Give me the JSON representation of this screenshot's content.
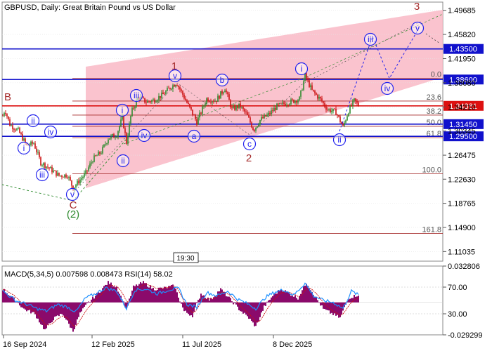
{
  "header": {
    "title": "GBPUSD, Daily:  Great Britain Pound vs US Dollar",
    "indicator_label": "MACD(5,34,5) 0.007598 0.008473 RSI(14) 58.02",
    "time_label": "19:30"
  },
  "colors": {
    "channel_fill": "#f9b9c6",
    "level_blue": "#1111cc",
    "level_red": "#dd1111",
    "fib_line": "#a52a2a",
    "wave_circle": "#2222ee",
    "wave_label_red": "#a52a2a",
    "wave_label_green": "#2e8b2e",
    "candle_up": "#2e8b2e",
    "candle_down": "#cc1111",
    "macd_hist": "#8b0a6b",
    "rsi_line": "#1e90ff",
    "signal_line": "#cc1111",
    "dashed_green": "#2e8b2e"
  },
  "chart_data": [
    {
      "type": "candlestick",
      "title": "GBPUSD, Daily:  Great Britain Pound vs US Dollar",
      "x_tick_labels": [
        "16 Sep 2024",
        "12 Feb 2025",
        "11 Jul 2025",
        "8 Dec 2025"
      ],
      "y_tick_labels": [
        "1.49685",
        "1.45820",
        "1.41950",
        "1.38080",
        "1.34210",
        "1.30345",
        "1.26475",
        "1.22630",
        "1.18765",
        "1.14900",
        "1.11035"
      ],
      "ylim": [
        1.095,
        1.51
      ],
      "grid": true,
      "price_path": [
        [
          0,
          1.328
        ],
        [
          3,
          1.338
        ],
        [
          10,
          1.314
        ],
        [
          22,
          1.304
        ],
        [
          34,
          1.28
        ],
        [
          44,
          1.284
        ],
        [
          54,
          1.253
        ],
        [
          66,
          1.244
        ],
        [
          80,
          1.232
        ],
        [
          92,
          1.233
        ],
        [
          100,
          1.212
        ],
        [
          108,
          1.223
        ],
        [
          118,
          1.236
        ],
        [
          128,
          1.258
        ],
        [
          140,
          1.27
        ],
        [
          150,
          1.292
        ],
        [
          162,
          1.298
        ],
        [
          170,
          1.325
        ],
        [
          176,
          1.285
        ],
        [
          183,
          1.334
        ],
        [
          193,
          1.358
        ],
        [
          204,
          1.35
        ],
        [
          215,
          1.353
        ],
        [
          228,
          1.362
        ],
        [
          238,
          1.373
        ],
        [
          247,
          1.381
        ],
        [
          256,
          1.362
        ],
        [
          266,
          1.34
        ],
        [
          276,
          1.318
        ],
        [
          290,
          1.355
        ],
        [
          303,
          1.352
        ],
        [
          316,
          1.372
        ],
        [
          326,
          1.338
        ],
        [
          337,
          1.344
        ],
        [
          347,
          1.33
        ],
        [
          357,
          1.305
        ],
        [
          366,
          1.321
        ],
        [
          378,
          1.33
        ],
        [
          390,
          1.343
        ],
        [
          402,
          1.348
        ],
        [
          414,
          1.352
        ],
        [
          422,
          1.355
        ],
        [
          430,
          1.392
        ],
        [
          440,
          1.368
        ],
        [
          452,
          1.354
        ],
        [
          462,
          1.338
        ],
        [
          474,
          1.334
        ],
        [
          484,
          1.31
        ],
        [
          492,
          1.336
        ],
        [
          500,
          1.352
        ],
        [
          506,
          1.345
        ]
      ],
      "levels": [
        {
          "label": "1.43500",
          "value": 1.435,
          "style": "blue"
        },
        {
          "label": "1.38600",
          "value": 1.386,
          "style": "blue"
        },
        {
          "label": "1.34381",
          "value": 1.34381,
          "style": "red"
        },
        {
          "label": "1.31450",
          "value": 1.3145,
          "style": "blue"
        },
        {
          "label": "1.29500",
          "value": 1.295,
          "style": "blue"
        }
      ],
      "fibonacci": [
        {
          "label": "0.0",
          "value": 1.388
        },
        {
          "label": "23.6",
          "value": 1.3515
        },
        {
          "label": "38.2",
          "value": 1.329
        },
        {
          "label": "50.0",
          "value": 1.311
        },
        {
          "label": "61.8",
          "value": 1.2928
        },
        {
          "label": "100.0",
          "value": 1.235
        },
        {
          "label": "161.8",
          "value": 1.1395
        }
      ],
      "waves": {
        "labels_red": [
          "B",
          "C",
          "1",
          "2",
          "3"
        ],
        "labels_green": [
          "(2)"
        ],
        "circled": [
          "i",
          "ii",
          "iv",
          "iii",
          "v",
          "iii",
          "ii",
          "iv",
          "a",
          "b",
          "c",
          "i",
          "ii",
          "iii",
          "iv",
          "v"
        ]
      },
      "projection": [
        [
          480,
          1.303
        ],
        [
          527,
          1.455
        ],
        [
          551,
          1.388
        ],
        [
          594,
          1.47
        ]
      ]
    },
    {
      "type": "line",
      "title": "MACD(5,34,5) 0.007598 0.008473 RSI(14) 58.02",
      "y_tick_labels": [
        "0.032806",
        "70.00",
        "30.00",
        "-0.029299"
      ],
      "series": [
        {
          "name": "MACD(5,34,5)",
          "type": "bar"
        },
        {
          "name": "RSI(14)",
          "type": "line"
        }
      ],
      "macd_path": [
        [
          0,
          0.012
        ],
        [
          18,
          0.002
        ],
        [
          30,
          -0.006
        ],
        [
          45,
          -0.01
        ],
        [
          60,
          -0.025
        ],
        [
          72,
          -0.015
        ],
        [
          85,
          -0.01
        ],
        [
          100,
          -0.026
        ],
        [
          110,
          -0.01
        ],
        [
          122,
          0.0
        ],
        [
          135,
          0.008
        ],
        [
          150,
          0.018
        ],
        [
          162,
          0.014
        ],
        [
          176,
          -0.006
        ],
        [
          186,
          0.014
        ],
        [
          200,
          0.018
        ],
        [
          215,
          0.012
        ],
        [
          230,
          0.013
        ],
        [
          244,
          0.015
        ],
        [
          258,
          -0.008
        ],
        [
          270,
          -0.012
        ],
        [
          282,
          0.008
        ],
        [
          295,
          0.002
        ],
        [
          310,
          0.012
        ],
        [
          322,
          0.004
        ],
        [
          336,
          -0.006
        ],
        [
          350,
          -0.014
        ],
        [
          360,
          -0.022
        ],
        [
          372,
          -0.004
        ],
        [
          384,
          0.006
        ],
        [
          396,
          0.012
        ],
        [
          408,
          0.008
        ],
        [
          420,
          0.004
        ],
        [
          432,
          0.018
        ],
        [
          444,
          0.006
        ],
        [
          456,
          -0.006
        ],
        [
          468,
          -0.01
        ],
        [
          480,
          -0.014
        ],
        [
          492,
          0.004
        ],
        [
          506,
          0.007
        ]
      ],
      "rsi_path": [
        [
          0,
          64
        ],
        [
          18,
          50
        ],
        [
          32,
          45
        ],
        [
          48,
          38
        ],
        [
          62,
          34
        ],
        [
          78,
          44
        ],
        [
          92,
          40
        ],
        [
          104,
          33
        ],
        [
          118,
          54
        ],
        [
          132,
          60
        ],
        [
          146,
          69
        ],
        [
          162,
          64
        ],
        [
          176,
          38
        ],
        [
          188,
          66
        ],
        [
          204,
          67
        ],
        [
          220,
          60
        ],
        [
          236,
          66
        ],
        [
          250,
          68
        ],
        [
          262,
          44
        ],
        [
          276,
          40
        ],
        [
          290,
          62
        ],
        [
          305,
          57
        ],
        [
          320,
          64
        ],
        [
          334,
          52
        ],
        [
          348,
          45
        ],
        [
          360,
          38
        ],
        [
          374,
          55
        ],
        [
          388,
          63
        ],
        [
          400,
          66
        ],
        [
          414,
          58
        ],
        [
          430,
          76
        ],
        [
          442,
          57
        ],
        [
          456,
          50
        ],
        [
          470,
          47
        ],
        [
          484,
          38
        ],
        [
          496,
          64
        ],
        [
          506,
          58
        ]
      ]
    }
  ]
}
